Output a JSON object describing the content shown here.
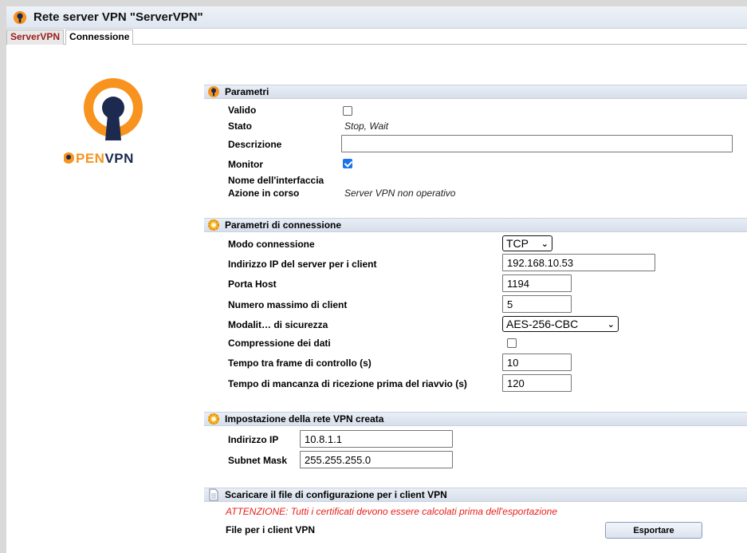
{
  "window": {
    "title": "Rete server VPN \"ServerVPN\""
  },
  "tabs": [
    {
      "label": "ServerVPN",
      "active": true
    },
    {
      "label": "Connessione",
      "active": false
    }
  ],
  "logo": {
    "text": "PENVPN"
  },
  "parametri": {
    "header": "Parametri",
    "valido_label": "Valido",
    "valido_checked": false,
    "stato_label": "Stato",
    "stato_value": "Stop, Wait",
    "descrizione_label": "Descrizione",
    "descrizione_value": "",
    "monitor_label": "Monitor",
    "monitor_checked": true,
    "nome_interfaccia_label": "Nome dell'interfaccia",
    "azione_label": "Azione in corso",
    "azione_value": "Server VPN non operativo"
  },
  "connessione": {
    "header": "Parametri di connessione",
    "modo_label": "Modo connessione",
    "modo_value": "TCP",
    "ip_server_label": "Indirizzo IP del server per i client",
    "ip_server_value": "192.168.10.53",
    "porta_label": "Porta Host",
    "porta_value": "1194",
    "max_client_label": "Numero massimo di client",
    "max_client_value": "5",
    "sicurezza_label": "Modalit… di sicurezza",
    "sicurezza_value": "AES-256-CBC",
    "compressione_label": "Compressione dei dati",
    "compressione_checked": false,
    "tempo_frame_label": "Tempo tra frame di controllo (s)",
    "tempo_frame_value": "10",
    "tempo_riavvio_label": "Tempo di mancanza di ricezione prima del riavvio (s)",
    "tempo_riavvio_value": "120"
  },
  "rete": {
    "header": "Impostazione della rete VPN creata",
    "ip_label": "Indirizzo IP",
    "ip_value": "10.8.1.1",
    "mask_label": "Subnet Mask",
    "mask_value": "255.255.255.0"
  },
  "download": {
    "header": "Scaricare il file di configurazione per i client VPN",
    "warning": "ATTENZIONE: Tutti i certificati devono essere calcolati prima dell'esportazione",
    "file_label": "File per i client VPN",
    "export_button": "Esportare"
  },
  "colors": {
    "accent_orange": "#f7931e",
    "logo_navy": "#1b2a4e",
    "active_tab": "#9b1a1a",
    "warning_red": "#e8201b",
    "checkbox_blue": "#1a73e8"
  }
}
